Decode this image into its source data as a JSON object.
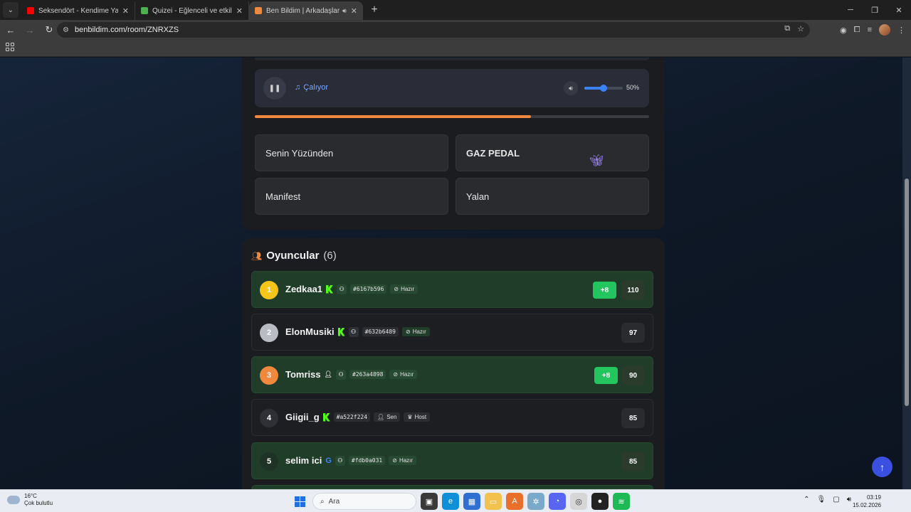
{
  "browser": {
    "tabs": [
      {
        "title": "Seksendört - Kendime Yalan Söyle",
        "favicon_color": "#ff0000",
        "active": false
      },
      {
        "title": "Quizei - Eğlenceli ve etkileşimli",
        "favicon_color": "#4caf50",
        "active": false
      },
      {
        "title": "Ben Bildim | Arkadaşlarınla",
        "favicon_color": "#f0883e",
        "active": true
      }
    ],
    "url": "benbildim.com/room/ZNRXZS"
  },
  "player": {
    "status": "Çalıyor",
    "volume_label": "50%",
    "volume_fraction": 0.5,
    "progress_fraction": 0.7
  },
  "answers": [
    {
      "label": "Senin Yüzünden"
    },
    {
      "label": "GAZ PEDAL"
    },
    {
      "label": "Manifest"
    },
    {
      "label": "Yalan"
    }
  ],
  "players_section": {
    "title": "Oyuncular",
    "count": "(6)",
    "rows": [
      {
        "rank": "1",
        "name": "Zedkaa1",
        "badge": "kick",
        "hash": "#6167b596",
        "status": "Hazır",
        "delta": "+8",
        "score": "110",
        "rank_color": "#f5c518",
        "highlight": true
      },
      {
        "rank": "2",
        "name": "ElonMusiki",
        "badge": "kick",
        "hash": "#632b6489",
        "status": "Hazır",
        "delta": "",
        "score": "97",
        "rank_color": "#b9bcc2",
        "highlight": false
      },
      {
        "rank": "3",
        "name": "Tomriss",
        "badge": "user",
        "hash": "#263a4898",
        "status": "Hazır",
        "delta": "+8",
        "score": "90",
        "rank_color": "#f0883e",
        "highlight": true
      },
      {
        "rank": "4",
        "name": "Giigii_g",
        "badge": "kick",
        "hash": "#a522f224",
        "status": "Sen",
        "status2": "Host",
        "delta": "",
        "score": "85",
        "rank_color": "#2e3035",
        "highlight": false
      },
      {
        "rank": "5",
        "name": "selim ici",
        "badge": "google",
        "hash": "#fdb0a031",
        "status": "Hazır",
        "delta": "",
        "score": "85",
        "rank_color": "#1e3326",
        "highlight": true
      }
    ]
  },
  "taskbar": {
    "temperature": "16°C",
    "weather": "Çok bulutlu",
    "search_placeholder": "Ara",
    "time": "03:19",
    "date": "15.02.2026"
  }
}
